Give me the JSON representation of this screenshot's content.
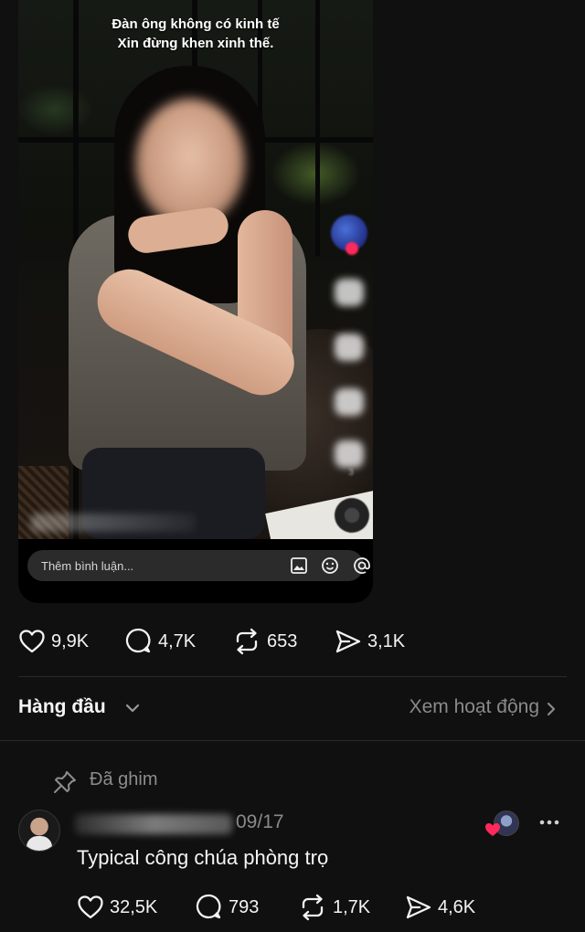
{
  "post": {
    "video": {
      "caption_line1": "Đàn ông không có kinh tế",
      "caption_line2": "Xin đừng khen xinh thế.",
      "side_rail_counts": [
        "",
        "",
        "",
        "3"
      ],
      "comment_placeholder": "Thêm bình luận..."
    },
    "stats": {
      "likes": "9,9K",
      "comments": "4,7K",
      "reposts": "653",
      "shares": "3,1K"
    }
  },
  "thread": {
    "sort_label": "Hàng đầu",
    "activity_link": "Xem hoạt động"
  },
  "pinned_comment": {
    "pinned_label": "Đã ghim",
    "date": "09/17",
    "text": "Typical công chúa phòng trọ",
    "stats": {
      "likes": "32,5K",
      "comments": "793",
      "reposts": "1,7K",
      "shares": "4,6K"
    }
  },
  "colors": {
    "background": "#101010",
    "text": "#f3f3f3",
    "muted": "#8a8a8a",
    "heart_red": "#ff2a5b"
  },
  "icons": [
    "heart-icon",
    "comment-icon",
    "repost-icon",
    "share-icon",
    "image-icon",
    "emoji-icon",
    "mention-icon",
    "chevron-down-icon",
    "chevron-right-icon",
    "pin-icon",
    "more-icon"
  ]
}
